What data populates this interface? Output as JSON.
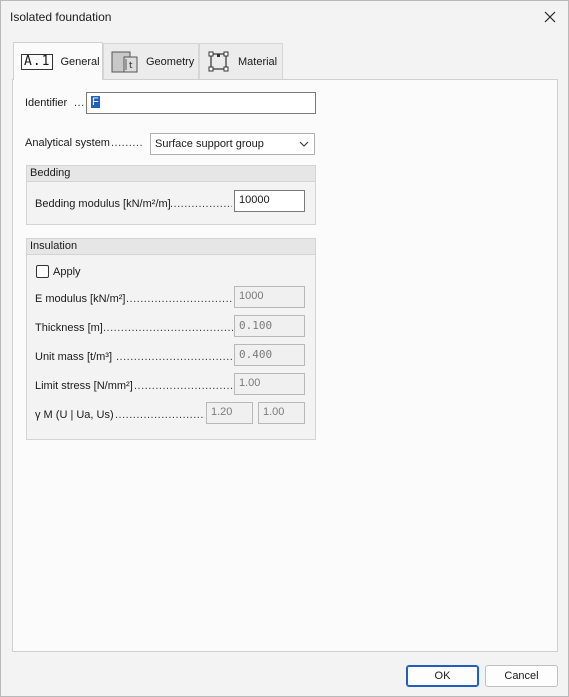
{
  "window": {
    "title": "Isolated foundation"
  },
  "tabs": [
    {
      "icon_text": "A.1",
      "label": "General"
    },
    {
      "icon_text": "t",
      "label": "Geometry"
    },
    {
      "label": "Material"
    }
  ],
  "general": {
    "identifier": {
      "label": "Identifier",
      "dots": "...",
      "value": "F"
    },
    "analytical_system": {
      "label": "Analytical system",
      "dots": ".........",
      "value": "Surface support group"
    },
    "bedding": {
      "title": "Bedding",
      "modulus": {
        "label": "Bedding modulus [kN/m²/m]",
        "dots": "...................",
        "value": "10000"
      }
    },
    "insulation": {
      "title": "Insulation",
      "apply_label": "Apply",
      "apply_checked": false,
      "e_modulus": {
        "label": "E modulus [kN/m²]",
        "dots": "..................................",
        "value": "1000"
      },
      "thickness": {
        "label": "Thickness [m]",
        "dots": "........................................",
        "value": "0.100"
      },
      "unit_mass": {
        "label": "Unit mass [t/m³]",
        "dots": "..................................",
        "value": "0.400"
      },
      "limit_stress": {
        "label": "Limit stress [N/mm²]",
        "dots": "..............................",
        "value": "1.00"
      },
      "gamma_m": {
        "label": "γ M (U | Ua, Us)",
        "dots": "...........................",
        "value1": "1.20",
        "value2": "1.00"
      }
    }
  },
  "buttons": {
    "ok": "OK",
    "cancel": "Cancel"
  }
}
